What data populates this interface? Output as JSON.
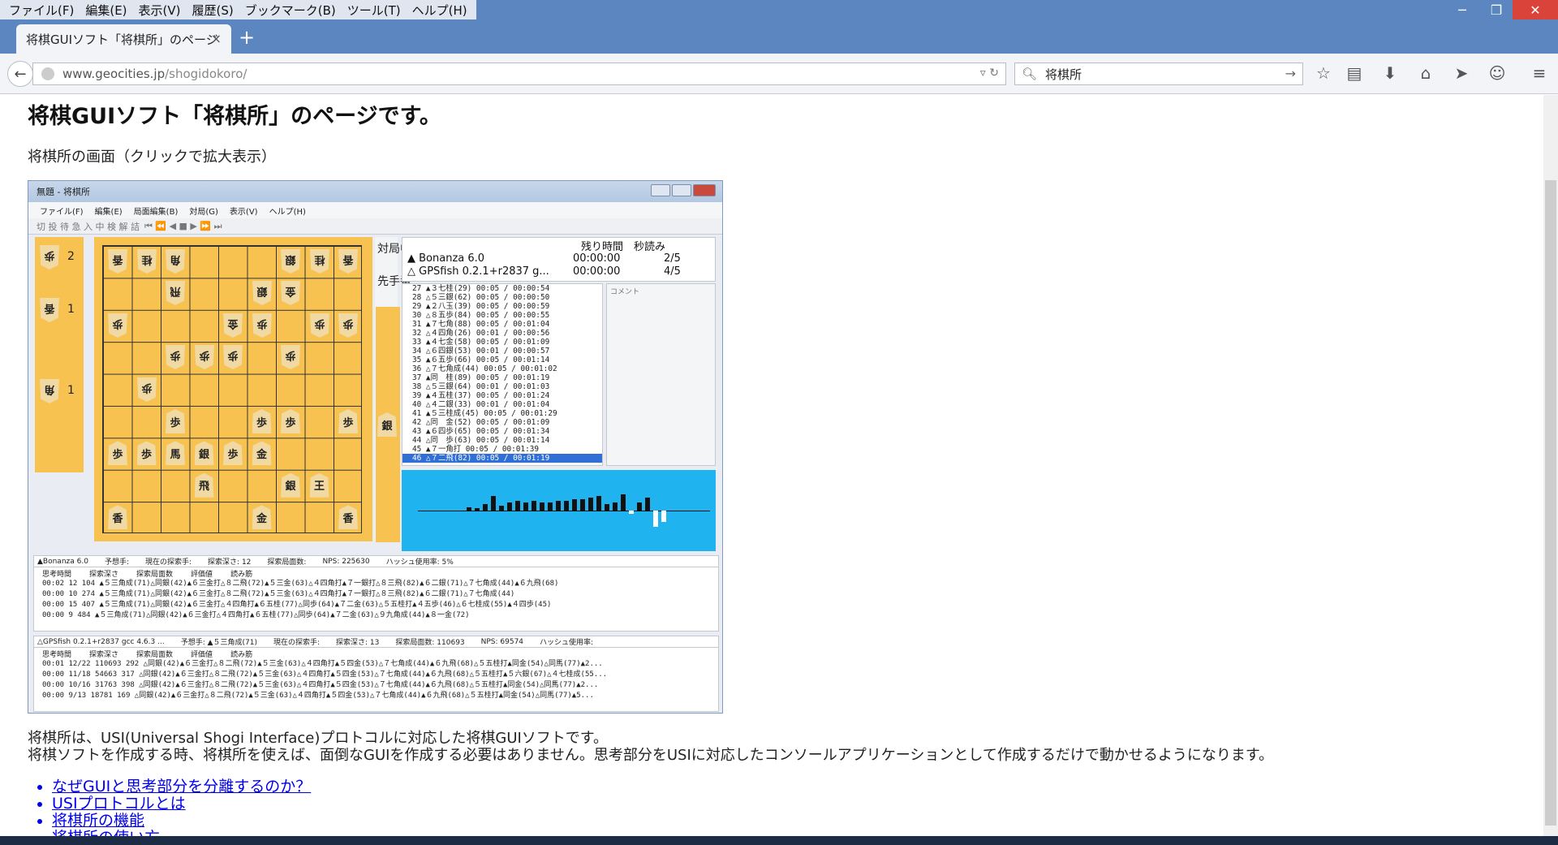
{
  "menubar": {
    "items": [
      "ファイル(F)",
      "編集(E)",
      "表示(V)",
      "履歴(S)",
      "ブックマーク(B)",
      "ツール(T)",
      "ヘルプ(H)"
    ]
  },
  "tab": {
    "title": "将棋GUIソフト「将棋所」のページ",
    "close": "×",
    "new": "+"
  },
  "address": {
    "host": "www.geocities.jp",
    "path": "/shogidokoro/"
  },
  "search": {
    "value": "将棋所"
  },
  "page": {
    "heading": "将棋GUIソフト「将棋所」のページです。",
    "caption": "将棋所の画面（クリックで拡大表示）",
    "para1": "将棋所は、USI(Universal Shogi Interface)プロトコルに対応した将棋GUIソフトです。",
    "para2": "将棋ソフトを作成する時、将棋所を使えば、面倒なGUIを作成する必要はありません。思考部分をUSIに対応したコンソールアプリケーションとして作成するだけで動かせるようになります。",
    "links": [
      "なぜGUIと思考部分を分離するのか？",
      "USIプロトコルとは",
      "将棋所の機能",
      "将棋所の使い方"
    ]
  },
  "screenshot": {
    "title": "無題 - 将棋所",
    "menu": [
      "ファイル(F)",
      "編集(E)",
      "局面編集(B)",
      "対局(G)",
      "表示(V)",
      "ヘルプ(H)"
    ],
    "toolbar": "切 投 待 急 入 中 検 解 詰",
    "status_top": "対局中",
    "status_turn": "先手番",
    "players": {
      "header": "残り時間　秒読み",
      "p1": "▲ Bonanza 6.0",
      "p1_time": "00:00:00",
      "p1_byo": "2/5",
      "p2": "△ GPSfish 0.2.1+r2837 g...",
      "p2_time": "00:00:00",
      "p2_byo": "4/5"
    },
    "moves": [
      "27 ▲３七桂(29)    00:05 / 00:00:54",
      "28 △５三銀(62)    00:05 / 00:00:50",
      "29 ▲２八玉(39)    00:05 / 00:00:59",
      "30 △８五歩(84)    00:05 / 00:00:55",
      "31 ▲７七角(88)    00:05 / 00:01:04",
      "32 △４四角(26)    00:01 / 00:00:56",
      "33 ▲４七金(58)    00:05 / 00:01:09",
      "34 △６四銀(53)    00:01 / 00:00:57",
      "35 ▲６五歩(66)    00:05 / 00:01:14",
      "36 △７七角成(44)  00:05 / 00:01:02",
      "37 ▲同　桂(89)    00:05 / 00:01:19",
      "38 △５三銀(64)    00:01 / 00:01:03",
      "39 ▲４五桂(37)    00:05 / 00:01:24",
      "40 △４二銀(33)    00:01 / 00:01:04",
      "41 ▲５三桂成(45)  00:05 / 00:01:29",
      "42 △同　金(52)    00:05 / 00:01:09",
      "43 ▲６四歩(65)    00:05 / 00:01:34",
      "44 △同　歩(63)    00:05 / 00:01:14",
      "45 ▲７一角打      00:05 / 00:01:39",
      "46 △７二飛(82)    00:05 / 00:01:19"
    ],
    "comment_label": "コメント",
    "engine1": {
      "hdr": [
        "▲Bonanza 6.0",
        "予想手:",
        "現在の探索手:",
        "探索深さ: 12",
        "探索局面数:",
        "NPS: 225630",
        "ハッシュ使用率: 5%"
      ],
      "cols": [
        "思考時間",
        "探索深さ",
        "探索局面数",
        "評価値",
        "読み筋"
      ],
      "lines": [
        "00:02   12        104  ▲５三角成(71)△同銀(42)▲６三金打△８二飛(72)▲５三金(63)△４四角打▲７一銀打△８三飛(82)▲６二銀(71)△７七角成(44)▲６九飛(68)",
        "00:00   10        274  ▲５三角成(71)△同銀(42)▲６三金打△８二飛(72)▲５三金(63)△４四角打▲７一銀打△８三飛(82)▲６二銀(71)△７七角成(44)",
        "00:00   15        407  ▲５三角成(71)△同銀(42)▲６三金打△４四角打▲６五桂(77)△同歩(64)▲７二金(63)△５五桂打▲４五歩(46)△６七桂成(55)▲４四歩(45)",
        "00:00    9        484  ▲５三角成(71)△同銀(42)▲６三金打△４四角打▲６五桂(77)△同歩(64)▲７二金(63)△９九角成(44)▲８一金(72)"
      ]
    },
    "engine2": {
      "hdr": [
        "△GPSfish 0.2.1+r2837 gcc 4.6.3 ...",
        "予想手: ▲５三角成(71)",
        "現在の探索手:",
        "探索深さ: 13",
        "探索局面数: 110693",
        "NPS: 69574",
        "ハッシュ使用率:"
      ],
      "cols": [
        "思考時間",
        "探索深さ",
        "探索局面数",
        "評価値",
        "読み筋"
      ],
      "lines": [
        "00:01  12/22   110693  292  △同銀(42)▲６三金打△８二飛(72)▲５三金(63)△４四角打▲５四金(53)△７七角成(44)▲６九飛(68)△５五桂打▲同金(54)△同馬(77)▲2...",
        "00:00  11/18    54663  317  △同銀(42)▲６三金打△８二飛(72)▲５三金(63)△４四角打▲５四金(53)△７七角成(44)▲６九飛(68)△５五桂打▲５六銀(67)△４七桂成(55...",
        "00:00  10/16    31763  398  △同銀(42)▲６三金打△８二飛(72)▲５三金(63)△４四角打▲５四金(53)△７七角成(44)▲６九飛(68)△５五桂打▲同金(54)△同馬(77)▲2...",
        "00:00   9/13    18781  169  △同銀(42)▲６三金打△８二飛(72)▲５三金(63)△４四角打▲５四金(53)△７七角成(44)▲６九飛(68)△５五桂打▲同金(54)△同馬(77)▲5..."
      ]
    }
  }
}
